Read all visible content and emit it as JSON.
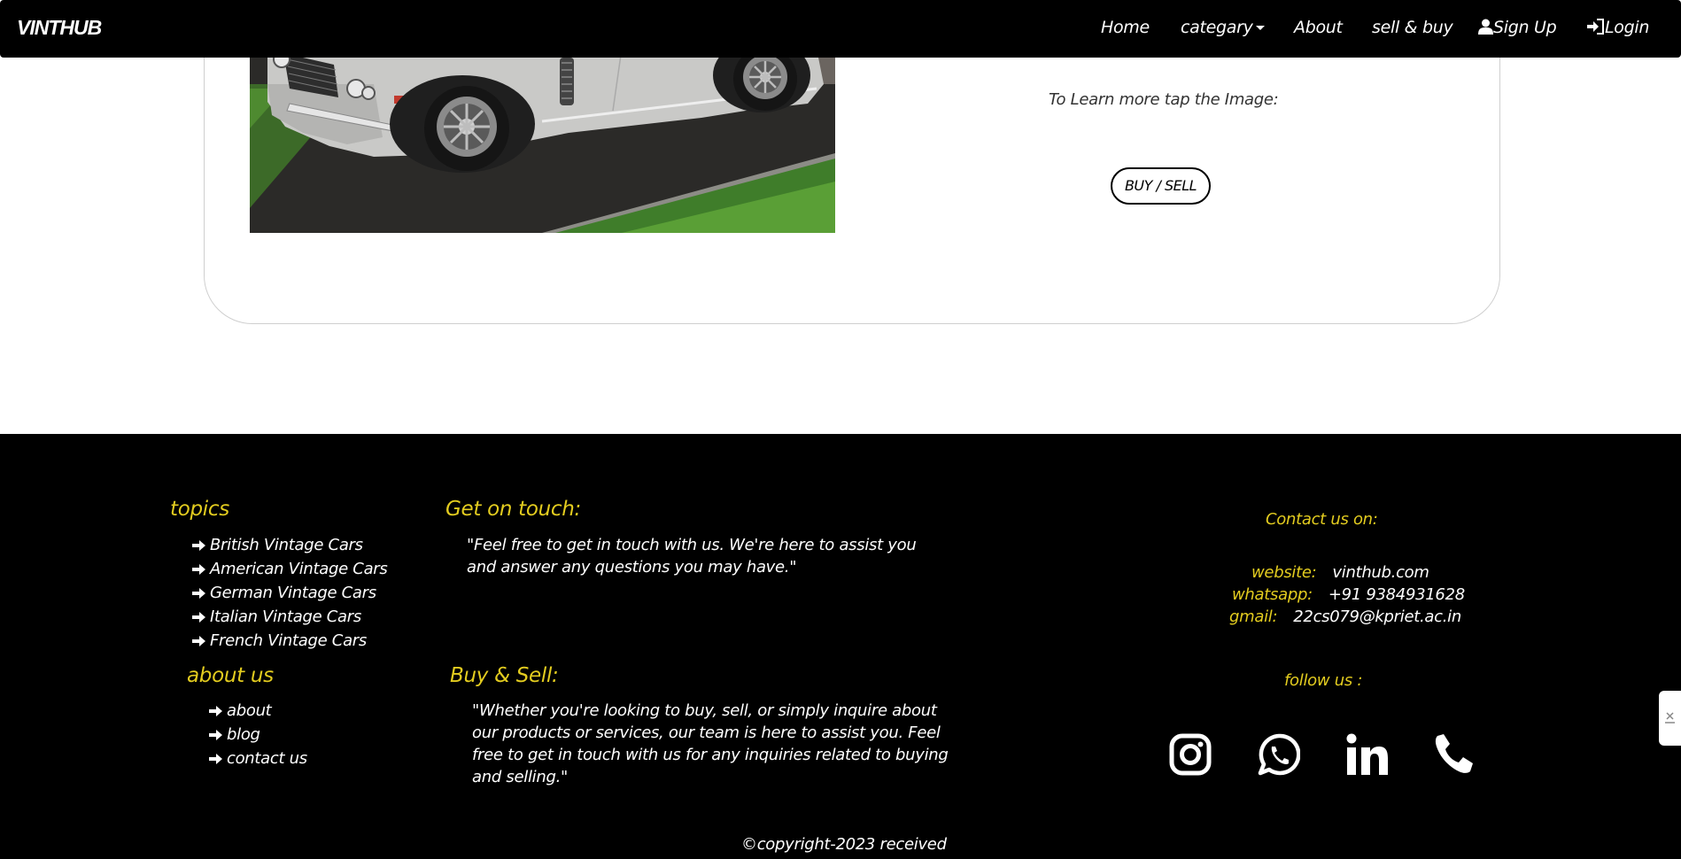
{
  "navbar": {
    "brand": "VINTHUB",
    "items": [
      {
        "label": "Home"
      },
      {
        "label": "categary"
      },
      {
        "label": "About"
      },
      {
        "label": "sell & buy"
      },
      {
        "label": "Sign Up",
        "icon": "user-icon"
      },
      {
        "label": "Login",
        "icon": "login-icon"
      }
    ]
  },
  "card": {
    "learn_text": "To Learn more tap the Image:",
    "button_label": "BUY / SELL"
  },
  "footer": {
    "topics": {
      "heading": "topics",
      "items": [
        "British Vintage Cars",
        "American Vintage Cars",
        "German Vintage Cars",
        "Italian Vintage Cars",
        "French Vintage Cars"
      ]
    },
    "about": {
      "heading": "about us",
      "items": [
        "about",
        "blog",
        "contact us"
      ]
    },
    "touch": {
      "heading": "Get on touch:",
      "text": "\"Feel free to get in touch with us. We're here to assist you and answer any questions you may have.\""
    },
    "buysell": {
      "heading": "Buy & Sell:",
      "text": "\"Whether you're looking to buy, sell, or simply inquire about our products or services, our team is here to assist you. Feel free to get in touch with us for any inquiries related to buying and selling.\""
    },
    "contact": {
      "heading": "Contact us on:",
      "website_label": "website:",
      "website": "vinthub.com",
      "whatsapp_label": "whatsapp:",
      "whatsapp": "+91 9384931628",
      "gmail_label": "gmail:",
      "gmail": "22cs079@kpriet.ac.in",
      "follow": "follow us :",
      "social_icons": [
        "instagram-icon",
        "whatsapp-icon",
        "linkedin-icon",
        "phone-icon"
      ]
    },
    "copyright": "©copyright-2023 received"
  },
  "colors": {
    "accent_yellow": "#e3cc1f",
    "footer_bg": "#000000",
    "navbar_bg": "#000000"
  }
}
